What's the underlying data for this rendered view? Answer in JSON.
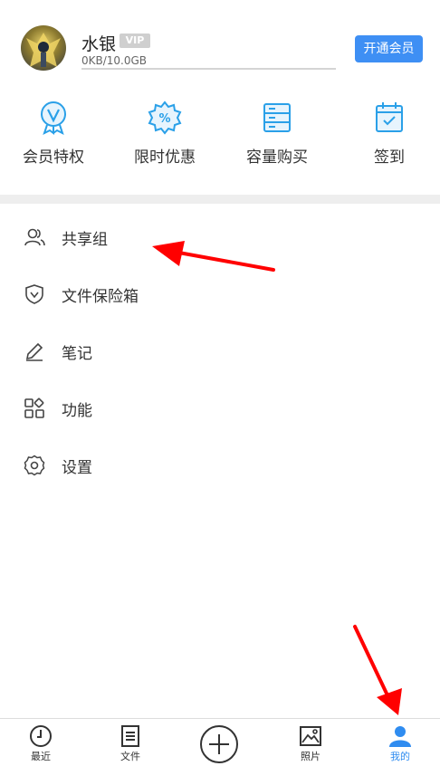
{
  "profile": {
    "username": "水银",
    "vip_badge": "VIP",
    "storage_text": "0KB/10.0GB",
    "storage_used_fraction": 0.0,
    "vip_button": "开通会员"
  },
  "features": [
    {
      "label": "会员特权",
      "icon": "medal-v-icon"
    },
    {
      "label": "限时优惠",
      "icon": "discount-icon"
    },
    {
      "label": "容量购买",
      "icon": "storage-icon"
    },
    {
      "label": "签到",
      "icon": "calendar-check-icon"
    }
  ],
  "menu": [
    {
      "label": "共享组",
      "icon": "users-icon"
    },
    {
      "label": "文件保险箱",
      "icon": "shield-icon"
    },
    {
      "label": "笔记",
      "icon": "pencil-icon"
    },
    {
      "label": "功能",
      "icon": "grid-icon"
    },
    {
      "label": "设置",
      "icon": "gear-icon"
    }
  ],
  "bottom_nav": [
    {
      "label": "最近",
      "icon": "clock-icon"
    },
    {
      "label": "文件",
      "icon": "document-icon"
    },
    {
      "label": "",
      "icon": "add-icon"
    },
    {
      "label": "照片",
      "icon": "image-icon"
    },
    {
      "label": "我的",
      "icon": "person-icon",
      "active": true
    }
  ],
  "colors": {
    "accent": "#3e8ff4",
    "annotation": "#ff0000",
    "icon_blue": "#2aa0e8"
  }
}
